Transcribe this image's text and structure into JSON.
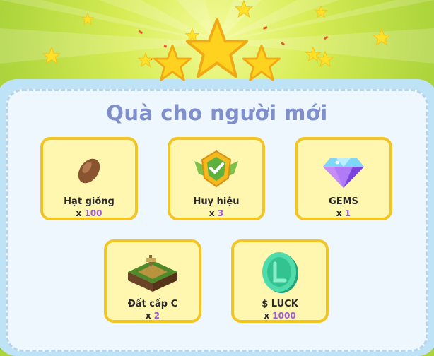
{
  "title": "Quà cho người mới",
  "rewards": [
    {
      "name": "Hạt giống",
      "qty_prefix": "x",
      "qty": "100",
      "icon": "seed-icon"
    },
    {
      "name": "Huy hiệu",
      "qty_prefix": "x",
      "qty": "3",
      "icon": "badge-icon"
    },
    {
      "name": "GEMS",
      "qty_prefix": "x",
      "qty": "1",
      "icon": "gem-icon"
    },
    {
      "name": "Đất cấp C",
      "qty_prefix": "x",
      "qty": "2",
      "icon": "land-plot-icon"
    },
    {
      "name": "$ LUCK",
      "qty_prefix": "x",
      "qty": "1000",
      "icon": "luck-coin-icon"
    }
  ],
  "colors": {
    "title": "#7f8fcb",
    "card_bg": "#fff7b0",
    "card_border": "#f3c524",
    "qty_value": "#a05ad6",
    "panel_bg": "#eef7fd",
    "star": "#ffd21f"
  }
}
